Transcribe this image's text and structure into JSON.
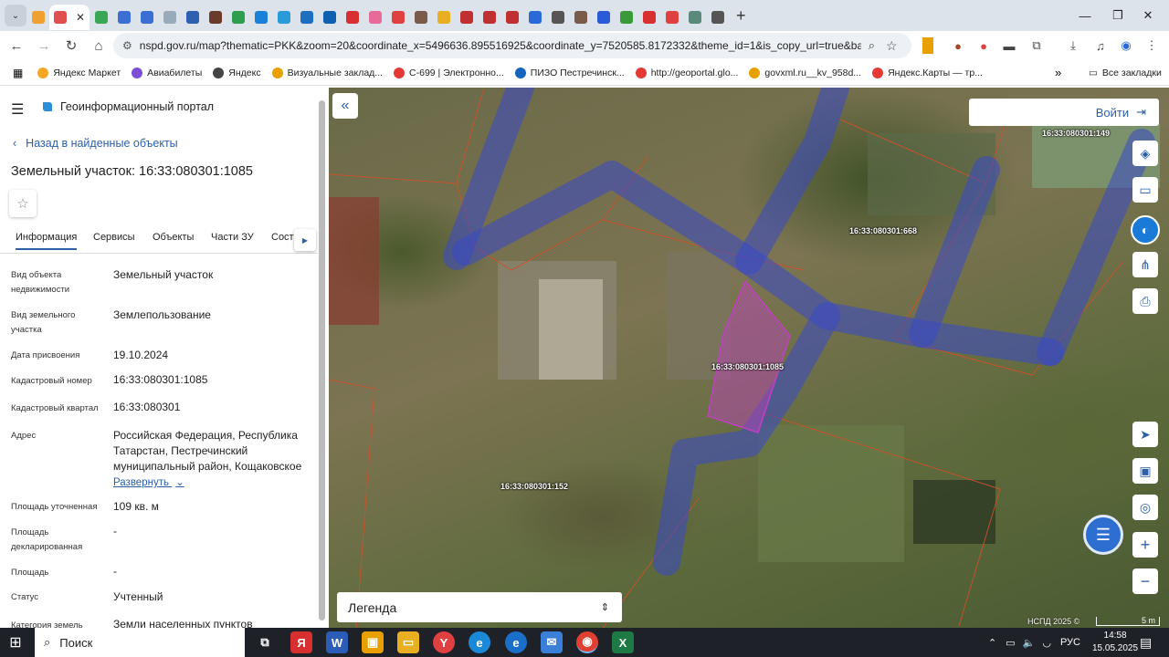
{
  "browser": {
    "url": "nspd.gov.ru/map?thematic=PKK&zoom=20&coordinate_x=5496636.895516925&coordinate_y=7520585.8172332&theme_id=1&is_copy_url=true&baseLaye...",
    "active_tab_close": "✕",
    "new_tab": "+",
    "win_min": "—",
    "win_max": "❐",
    "win_close": "✕"
  },
  "bookmarks": [
    {
      "label": "Яндекс Маркет",
      "color": "#f5a623"
    },
    {
      "label": "Авиабилеты",
      "color": "#7b4fd6"
    },
    {
      "label": "Яндекс",
      "color": "#444444"
    },
    {
      "label": "Визуальные заклад...",
      "color": "#e8a000"
    },
    {
      "label": "С-699 | Электронно...",
      "color": "#e53935"
    },
    {
      "label": "ПИЗО Пестречинск...",
      "color": "#1565c0"
    },
    {
      "label": "http://geoportal.glo...",
      "color": "#e53935"
    },
    {
      "label": "govxml.ru__kv_958d...",
      "color": "#e8a000"
    },
    {
      "label": "Яндекс.Карты — тр...",
      "color": "#e53935"
    }
  ],
  "bookmarks_more": "»",
  "bookmarks_all": "Все закладки",
  "panel": {
    "portal_title": "Геоинформационный портал",
    "back_link": "Назад в найденные объекты",
    "object_title": "Земельный участок: 16:33:080301:1085",
    "tabs": [
      "Информация",
      "Сервисы",
      "Объекты",
      "Части ЗУ",
      "Соста"
    ],
    "properties": [
      {
        "key": "Вид объекта недвижимости",
        "value": "Земельный участок"
      },
      {
        "key": "Вид земельного участка",
        "value": "Землепользование"
      },
      {
        "key": "Дата присвоения",
        "value": "19.10.2024"
      },
      {
        "key": "Кадастровый номер",
        "value": "16:33:080301:1085"
      },
      {
        "key": "Кадастровый квартал",
        "value": "16:33:080301"
      },
      {
        "key": "Адрес",
        "value": "Российская Федерация, Республика Татарстан, Пестречинский муниципальный район, Кощаковское"
      },
      {
        "key": "Площадь уточненная",
        "value": "109 кв. м"
      },
      {
        "key": "Площадь декларированная",
        "value": "-"
      },
      {
        "key": "Площадь",
        "value": "-"
      },
      {
        "key": "Статус",
        "value": "Учтенный"
      },
      {
        "key": "Категория земель",
        "value": "Земли населенных пунктов"
      }
    ],
    "expand_label": "Развернуть"
  },
  "map": {
    "login_label": "Войти",
    "legend_label": "Легенда",
    "labels": [
      "16:33:080301:149",
      "16:33:080301:668",
      "16:33:080301:1085",
      "16:33:080301:152"
    ],
    "attribution": "НСПД 2025 ©",
    "scale_label": "5 m",
    "highlight_color": "#c040c0",
    "network_color": "#3848c8"
  },
  "taskbar": {
    "search_placeholder": "Поиск",
    "lang": "РУС",
    "time": "14:58",
    "date": "15.05.2025"
  }
}
